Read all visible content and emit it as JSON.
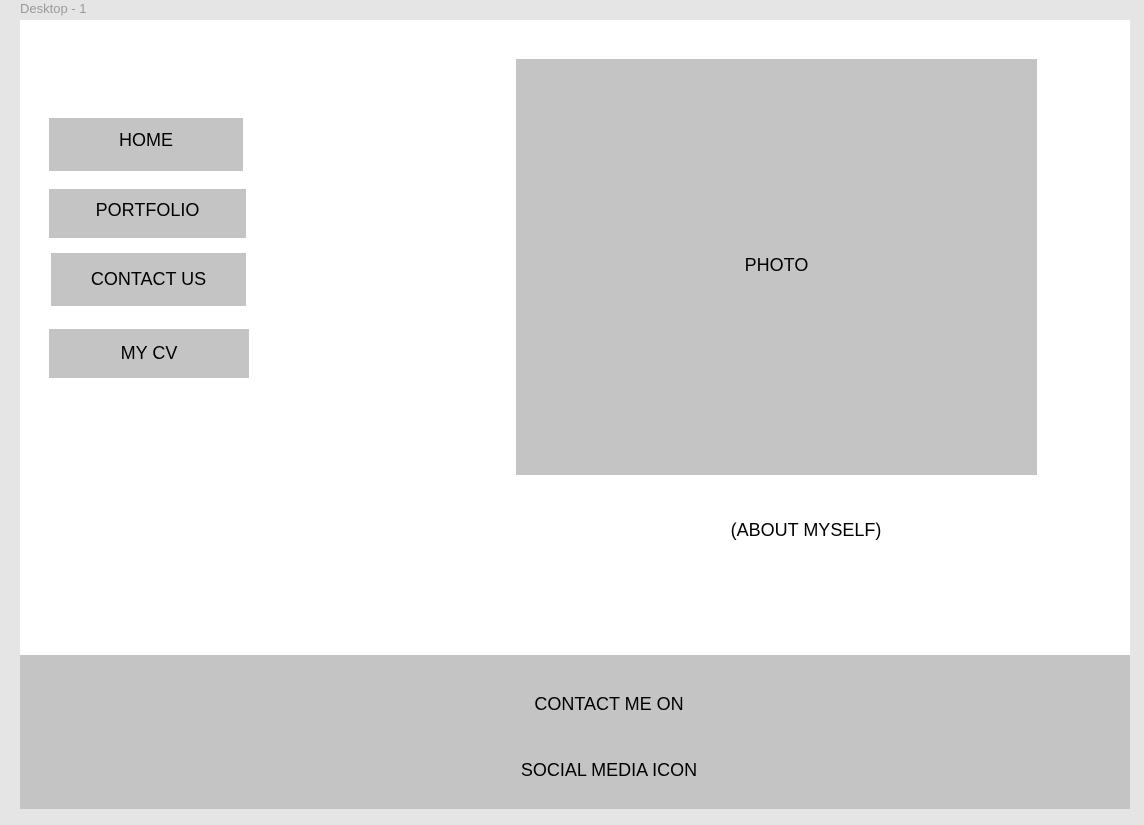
{
  "frame": {
    "label": "Desktop - 1"
  },
  "nav": {
    "home": "HOME",
    "portfolio": "PORTFOLIO",
    "contact_us": "CONTACT US",
    "my_cv": "MY CV"
  },
  "main": {
    "photo_label": "PHOTO",
    "about_text": "(ABOUT MYSELF)"
  },
  "footer": {
    "contact_text": "CONTACT ME ON",
    "social_text": "SOCIAL MEDIA ICON"
  },
  "colors": {
    "canvas_background": "#e5e5e5",
    "frame_background": "#ffffff",
    "placeholder_gray": "#c4c4c4",
    "label_gray": "#9a9a9a"
  }
}
